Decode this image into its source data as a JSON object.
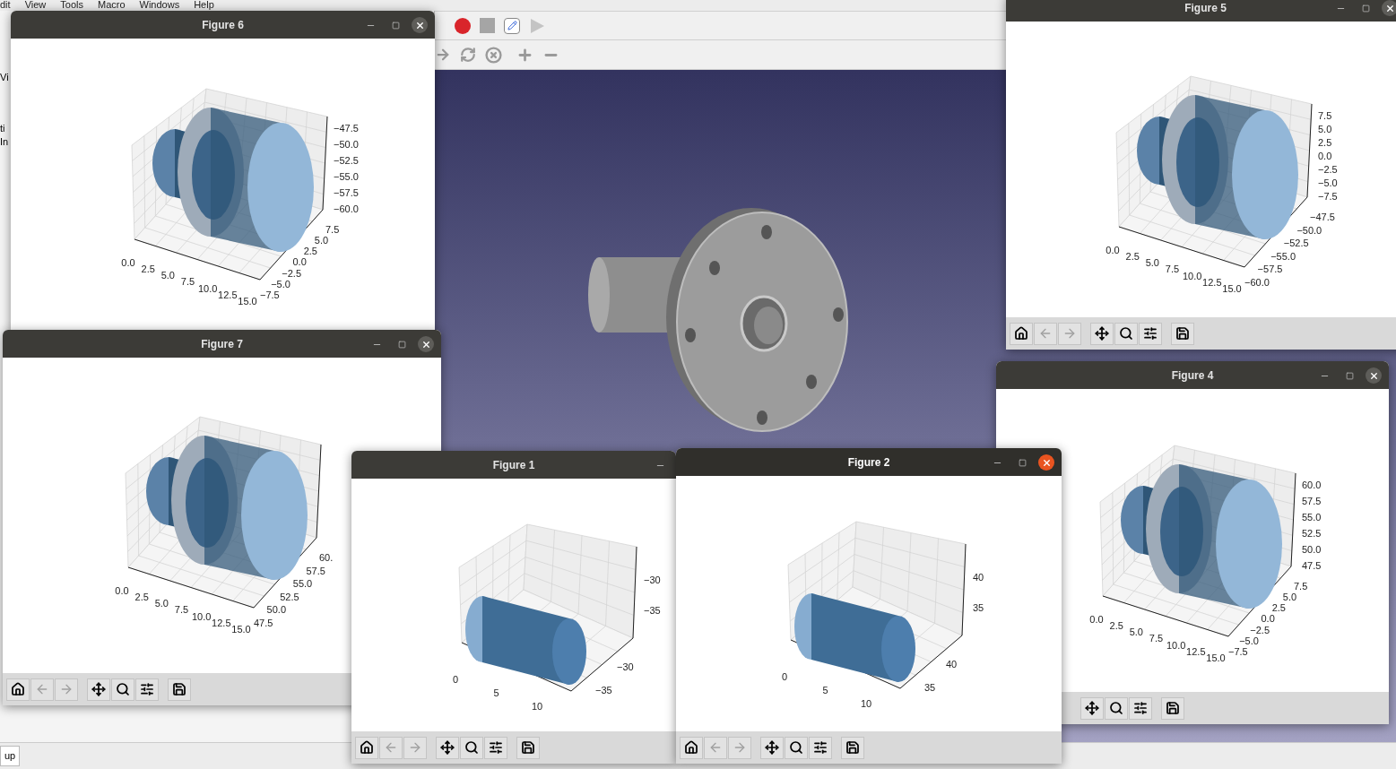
{
  "menu_bar": [
    "dit",
    "View",
    "Tools",
    "Macro",
    "Windows",
    "Help"
  ],
  "left_panel_fragments": [
    "Vi",
    "ti",
    "In"
  ],
  "status_tab": "up",
  "figures": [
    {
      "title": "Figure 6",
      "active": false,
      "kind": "stepped",
      "controls": {
        "minimize": true,
        "maximize": true,
        "close": true
      },
      "x_ticks": [
        "0.0",
        "2.5",
        "5.0",
        "7.5",
        "10.0",
        "12.5",
        "15.0"
      ],
      "y_ticks": [
        "7.5",
        "5.0",
        "2.5",
        "0.0",
        "−2.5",
        "−5.0",
        "−7.5"
      ],
      "z_ticks": [
        "−47.5",
        "−50.0",
        "−52.5",
        "−55.0",
        "−57.5",
        "−60.0"
      ]
    },
    {
      "title": "Figure 5",
      "active": false,
      "kind": "stepped",
      "controls": {
        "minimize": true,
        "maximize": true,
        "close": true
      },
      "x_ticks": [
        "0.0",
        "2.5",
        "5.0",
        "7.5",
        "10.0",
        "12.5",
        "15.0"
      ],
      "y_ticks": [
        "−47.5",
        "−50.0",
        "−52.5",
        "−55.0",
        "−57.5",
        "−60.0"
      ],
      "z_ticks": [
        "7.5",
        "5.0",
        "2.5",
        "0.0",
        "−2.5",
        "−5.0",
        "−7.5"
      ],
      "toolbar": [
        {
          "kind": "home",
          "disabled": false
        },
        {
          "kind": "back",
          "disabled": true
        },
        {
          "kind": "forward",
          "disabled": true
        },
        {
          "kind": "pan",
          "disabled": false
        },
        {
          "kind": "zoom",
          "disabled": false
        },
        {
          "kind": "configure",
          "disabled": false
        },
        {
          "kind": "save",
          "disabled": false
        }
      ]
    },
    {
      "title": "Figure 7",
      "active": false,
      "kind": "stepped",
      "controls": {
        "minimize": true,
        "maximize": true,
        "close": true
      },
      "x_ticks": [
        "0.0",
        "2.5",
        "5.0",
        "7.5",
        "10.0",
        "12.5",
        "15.0"
      ],
      "y_ticks": [
        "60.",
        "57.5",
        "55.0",
        "52.5",
        "50.0",
        "47.5"
      ],
      "toolbar": [
        {
          "kind": "home",
          "disabled": false
        },
        {
          "kind": "back",
          "disabled": true
        },
        {
          "kind": "forward",
          "disabled": true
        },
        {
          "kind": "pan",
          "disabled": false
        },
        {
          "kind": "zoom",
          "disabled": false
        },
        {
          "kind": "configure",
          "disabled": false
        },
        {
          "kind": "save",
          "disabled": false
        }
      ]
    },
    {
      "title": "Figure 4",
      "active": false,
      "kind": "stepped",
      "controls": {
        "minimize": true,
        "maximize": true,
        "close": true
      },
      "x_ticks": [
        "0.0",
        "2.5",
        "5.0",
        "7.5",
        "10.0",
        "12.5",
        "15.0"
      ],
      "y_ticks": [
        "7.5",
        "5.0",
        "2.5",
        "0.0",
        "−2.5",
        "−5.0",
        "−7.5"
      ],
      "z_ticks": [
        "60.0",
        "57.5",
        "55.0",
        "52.5",
        "50.0",
        "47.5"
      ],
      "toolbar": [
        {
          "kind": "pan",
          "disabled": false
        },
        {
          "kind": "zoom",
          "disabled": false
        },
        {
          "kind": "configure",
          "disabled": false
        },
        {
          "kind": "save",
          "disabled": false
        }
      ]
    },
    {
      "title": "Figure 1",
      "active": false,
      "kind": "rod",
      "controls": {
        "minimize": true
      },
      "x_ticks": [
        "0",
        "5",
        "10"
      ],
      "y_ticks": [
        "−30",
        "−35"
      ],
      "z_ticks": [
        "−30",
        "−35"
      ],
      "toolbar": [
        {
          "kind": "home",
          "disabled": false
        },
        {
          "kind": "back",
          "disabled": true
        },
        {
          "kind": "forward",
          "disabled": true
        },
        {
          "kind": "pan",
          "disabled": false
        },
        {
          "kind": "zoom",
          "disabled": false
        },
        {
          "kind": "configure",
          "disabled": false
        },
        {
          "kind": "save",
          "disabled": false
        }
      ]
    },
    {
      "title": "Figure 2",
      "active": true,
      "kind": "rod",
      "controls": {
        "minimize": true,
        "maximize": true,
        "close": true
      },
      "x_ticks": [
        "0",
        "5",
        "10"
      ],
      "y_ticks": [
        "40",
        "35"
      ],
      "z_ticks": [
        "40",
        "35"
      ],
      "toolbar": [
        {
          "kind": "home",
          "disabled": false
        },
        {
          "kind": "back",
          "disabled": true
        },
        {
          "kind": "forward",
          "disabled": true
        },
        {
          "kind": "pan",
          "disabled": false
        },
        {
          "kind": "zoom",
          "disabled": false
        },
        {
          "kind": "configure",
          "disabled": false
        },
        {
          "kind": "save",
          "disabled": false
        }
      ]
    }
  ]
}
